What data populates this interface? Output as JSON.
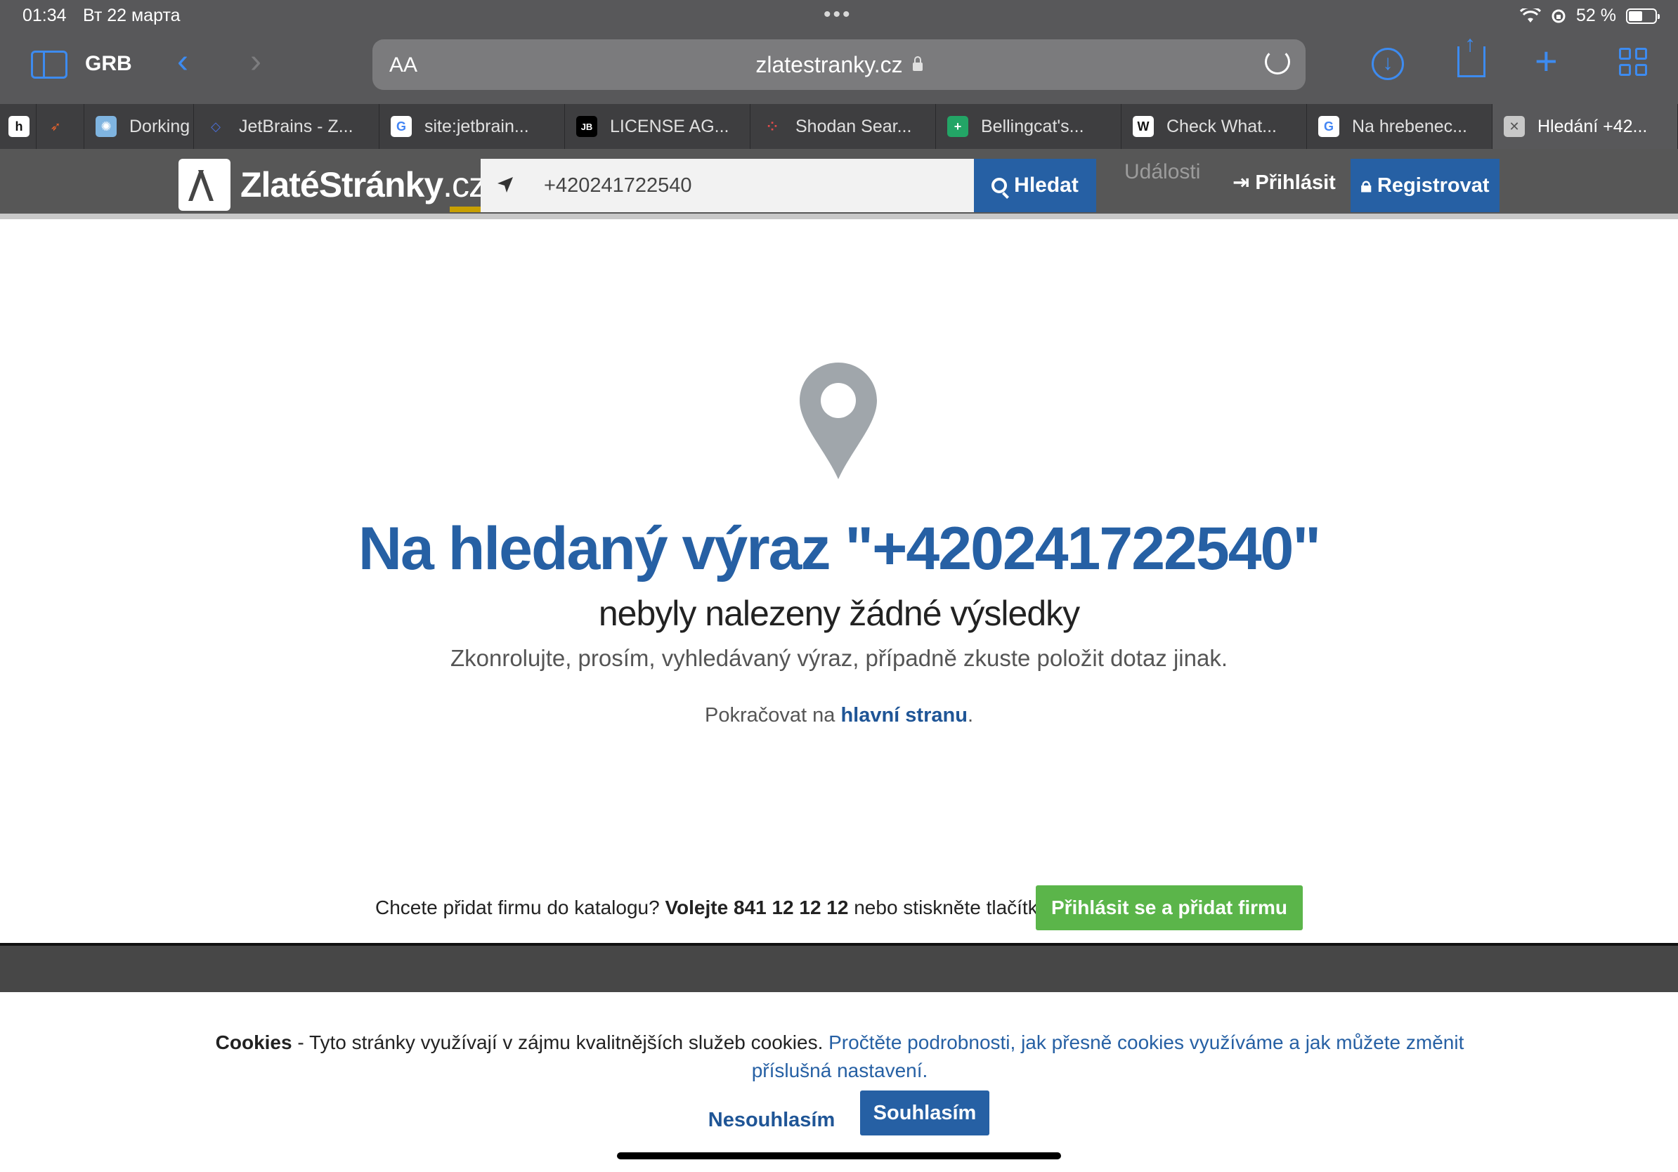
{
  "status_bar": {
    "time": "01:34",
    "date": "Вт 22 марта",
    "multitask": "•••",
    "battery": "52 %",
    "battery_level": 0.52
  },
  "safari": {
    "tab_group": "GRB",
    "aa_label": "AA",
    "url": "zlatestranky.cz",
    "tabs": [
      {
        "title": "",
        "icon": "h1-icon"
      },
      {
        "title": "",
        "icon": "orange-bird-icon"
      },
      {
        "title": "Dorking",
        "icon": "dorking-icon"
      },
      {
        "title": "JetBrains - Z...",
        "icon": "jetbrains-icon"
      },
      {
        "title": "site:jetbrain...",
        "icon": "google-icon"
      },
      {
        "title": "LICENSE AG...",
        "icon": "jb-icon"
      },
      {
        "title": "Shodan Sear...",
        "icon": "shodan-icon"
      },
      {
        "title": "Bellingcat's...",
        "icon": "sheets-icon"
      },
      {
        "title": "Check What...",
        "icon": "w-icon"
      },
      {
        "title": "Na hrebenec...",
        "icon": "google-icon"
      },
      {
        "title": "Hledání +42...",
        "icon": "close-icon"
      }
    ]
  },
  "site_header": {
    "logo_main": "ZlatéStránky",
    "logo_tld": ".cz",
    "search_value": "+420241722540",
    "search_button": "Hledat",
    "events": "Události",
    "login": "Přihlásit",
    "register": "Registrovat"
  },
  "main": {
    "title": "Na hledaný výraz \"+420241722540\"",
    "subtitle": "nebyly nalezeny žádné výsledky",
    "hint": "Zkonrolujte, prosím, vyhledávaný výraz, případně zkuste položit dotaz jinak.",
    "continue_prefix": "Pokračovat na ",
    "continue_link": "hlavní stranu",
    "continue_suffix": "."
  },
  "add_firm": {
    "prefix": "Chcete přidat firmu do katalogu? ",
    "phone": "Volejte 841 12 12 12",
    "suffix": " nebo stiskněte tlačítko",
    "button": "Přihlásit se a přidat firmu"
  },
  "cookies": {
    "label": "Cookies",
    "text": " - Tyto stránky využívají v zájmu kvalitnějších služeb cookies. ",
    "link": "Pročtěte podrobnosti, jak přesně cookies využíváme a jak můžete změnit příslušná nastavení.",
    "decline": "Nesouhlasím",
    "accept": "Souhlasím"
  },
  "colors": {
    "brand_blue": "#2660a4",
    "cta_green": "#5bb54a",
    "header_gray": "#575757",
    "safari_blue": "#3d8bf0"
  }
}
